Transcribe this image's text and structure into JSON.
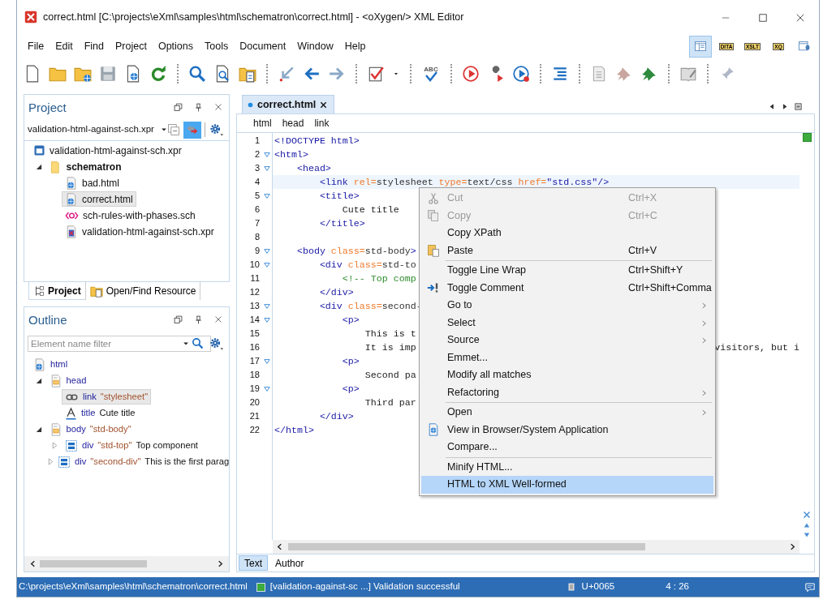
{
  "window": {
    "title": "correct.html [C:\\projects\\eXml\\samples\\html\\schematron\\correct.html] - <oXygen/> XML Editor"
  },
  "menu": [
    "File",
    "Edit",
    "Find",
    "Project",
    "Options",
    "Tools",
    "Document",
    "Window",
    "Help"
  ],
  "toolbar": {
    "spellcheck_label": "ABC"
  },
  "perspectives": [
    {
      "kind": "editor",
      "selected": true
    },
    {
      "kind": "tagged",
      "label": "DITA",
      "selected": false
    },
    {
      "kind": "tagged",
      "label": "XSLT",
      "selected": false
    },
    {
      "kind": "tagged",
      "label": "XQ",
      "selected": false
    },
    {
      "kind": "database",
      "selected": false
    }
  ],
  "project": {
    "title": "Project",
    "selector": "validation-html-against-sch.xpr",
    "tree": [
      {
        "label": "validation-html-against-sch.xpr",
        "kind": "project",
        "selected": false,
        "children": [
          {
            "label": "schematron",
            "kind": "folder",
            "selected": false,
            "expanded": true,
            "children": [
              {
                "label": "bad.html",
                "kind": "html",
                "selected": false
              },
              {
                "label": "correct.html",
                "kind": "html",
                "selected": true
              },
              {
                "label": "sch-rules-with-phases.sch",
                "kind": "sch",
                "selected": false
              },
              {
                "label": "validation-html-against-sch.xpr",
                "kind": "xpr",
                "selected": false
              }
            ]
          }
        ]
      }
    ],
    "tabs": [
      {
        "label": "Project",
        "selected": true
      },
      {
        "label": "Open/Find Resource",
        "selected": false
      }
    ]
  },
  "outline": {
    "title": "Outline",
    "filter": {
      "placeholder": "Element name filter"
    },
    "tree": [
      {
        "name": "html",
        "kind": "document",
        "selected": false,
        "children": [
          {
            "name": "head",
            "kind": "head",
            "selected": false,
            "expanded": true,
            "children": [
              {
                "name": "link",
                "attr": "\"stylesheet\"",
                "kind": "link",
                "selected": true
              },
              {
                "name": "title",
                "text": "Cute title",
                "kind": "title",
                "selected": false
              }
            ]
          },
          {
            "name": "body",
            "attr": "\"std-body\"",
            "kind": "head",
            "selected": false,
            "expanded": true,
            "children": [
              {
                "name": "div",
                "attr": "\"std-top\"",
                "text": "Top component",
                "kind": "div",
                "selected": false,
                "expanded": false
              },
              {
                "name": "div",
                "attr": "\"second-div\"",
                "text": "This is the first parag",
                "kind": "div",
                "selected": false,
                "expanded": false
              }
            ]
          }
        ]
      }
    ]
  },
  "editor": {
    "tab": {
      "label": "correct.html",
      "selected": true
    },
    "breadcrumb": [
      "html",
      "head",
      "link"
    ],
    "lines": [
      {
        "number": "1",
        "fold": false,
        "current": false,
        "tokens": [
          {
            "kind": "tag",
            "text": "<!DOCTYPE html>"
          }
        ]
      },
      {
        "number": "2",
        "fold": true,
        "current": false,
        "tokens": [
          {
            "kind": "tag",
            "text": "<html>"
          }
        ]
      },
      {
        "number": "3",
        "fold": true,
        "current": false,
        "tokens": [
          {
            "kind": "tag",
            "text": "    <head>"
          }
        ]
      },
      {
        "number": "4",
        "fold": false,
        "current": true,
        "tokens": [
          {
            "kind": "tag",
            "text": "        <link "
          },
          {
            "kind": "attr",
            "text": "rel="
          },
          {
            "kind": "value",
            "text": "stylesheet "
          },
          {
            "kind": "attr",
            "text": "type="
          },
          {
            "kind": "value",
            "text": "text/css "
          },
          {
            "kind": "attr",
            "text": "href="
          },
          {
            "kind": "string",
            "text": "\"std.css\""
          },
          {
            "kind": "tag",
            "text": "/>"
          }
        ]
      },
      {
        "number": "5",
        "fold": true,
        "current": false,
        "tokens": [
          {
            "kind": "tag",
            "text": "        <title>"
          }
        ]
      },
      {
        "number": "6",
        "fold": false,
        "current": false,
        "tokens": [
          {
            "kind": "text",
            "text": "            Cute title"
          }
        ]
      },
      {
        "number": "7",
        "fold": false,
        "current": false,
        "tokens": [
          {
            "kind": "tag",
            "text": "        </title>"
          }
        ]
      },
      {
        "number": "8",
        "fold": false,
        "current": false
      },
      {
        "number": "9",
        "fold": true,
        "current": false,
        "tokens": [
          {
            "kind": "tag",
            "text": "    <body "
          },
          {
            "kind": "attr",
            "text": "class="
          },
          {
            "kind": "value",
            "text": "std-body"
          },
          {
            "kind": "tag",
            "text": ">"
          }
        ]
      },
      {
        "number": "10",
        "fold": true,
        "current": false,
        "tokens": [
          {
            "kind": "tag",
            "text": "        <div "
          },
          {
            "kind": "attr",
            "text": "class="
          },
          {
            "kind": "value",
            "text": "std-to"
          }
        ]
      },
      {
        "number": "11",
        "fold": false,
        "current": false,
        "tokens": [
          {
            "kind": "comment",
            "text": "            <!-- Top comp"
          }
        ]
      },
      {
        "number": "12",
        "fold": false,
        "current": false,
        "tokens": [
          {
            "kind": "tag",
            "text": "        </div>"
          }
        ]
      },
      {
        "number": "13",
        "fold": true,
        "current": false,
        "tokens": [
          {
            "kind": "tag",
            "text": "        <div "
          },
          {
            "kind": "attr",
            "text": "class="
          },
          {
            "kind": "value",
            "text": "second-"
          }
        ]
      },
      {
        "number": "14",
        "fold": true,
        "current": false,
        "tokens": [
          {
            "kind": "tag",
            "text": "            <p>"
          }
        ]
      },
      {
        "number": "15",
        "fold": false,
        "current": false,
        "tokens": [
          {
            "kind": "text",
            "text": "                This is t"
          }
        ]
      },
      {
        "number": "16",
        "fold": false,
        "current": false,
        "tokens": [
          {
            "kind": "text",
            "text": "                It is imp"
          }
        ],
        "tail": "visitors, but i"
      },
      {
        "number": "17",
        "fold": true,
        "current": false,
        "tokens": [
          {
            "kind": "tag",
            "text": "            <p>"
          }
        ]
      },
      {
        "number": "18",
        "fold": false,
        "current": false,
        "tokens": [
          {
            "kind": "text",
            "text": "                Second pa"
          }
        ]
      },
      {
        "number": "19",
        "fold": true,
        "current": false,
        "tokens": [
          {
            "kind": "tag",
            "text": "            <p>"
          }
        ]
      },
      {
        "number": "20",
        "fold": false,
        "current": false,
        "tokens": [
          {
            "kind": "text",
            "text": "                Third par"
          }
        ]
      },
      {
        "number": "21",
        "fold": false,
        "current": false,
        "tokens": [
          {
            "kind": "tag",
            "text": "        </div>"
          }
        ]
      },
      {
        "number": "22",
        "fold": false,
        "current": false,
        "tokens": [
          {
            "kind": "tag",
            "text": "</html>"
          }
        ]
      }
    ],
    "modes": [
      {
        "label": "Text",
        "selected": true
      },
      {
        "label": "Author",
        "selected": false
      }
    ]
  },
  "context_menu": [
    [
      {
        "label": "Cut",
        "shortcut": "Ctrl+X",
        "disabled": true,
        "submenu": false,
        "selected": false
      },
      {
        "label": "Copy",
        "shortcut": "Ctrl+C",
        "disabled": true,
        "submenu": false,
        "selected": false
      },
      {
        "label": "Copy XPath",
        "disabled": false,
        "submenu": false,
        "selected": false
      },
      {
        "label": "Paste",
        "shortcut": "Ctrl+V",
        "disabled": false,
        "submenu": false,
        "selected": false
      }
    ],
    [
      {
        "label": "Toggle Line Wrap",
        "shortcut": "Ctrl+Shift+Y",
        "disabled": false,
        "submenu": false,
        "selected": false
      },
      {
        "label": "Toggle Comment",
        "shortcut": "Ctrl+Shift+Comma",
        "disabled": false,
        "submenu": false,
        "selected": false
      },
      {
        "label": "Go to",
        "disabled": false,
        "submenu": true,
        "selected": false
      },
      {
        "label": "Select",
        "disabled": false,
        "submenu": true,
        "selected": false
      },
      {
        "label": "Source",
        "disabled": false,
        "submenu": true,
        "selected": false
      },
      {
        "label": "Emmet...",
        "disabled": false,
        "submenu": false,
        "selected": false
      },
      {
        "label": "Modify all matches",
        "disabled": false,
        "submenu": false,
        "selected": false
      },
      {
        "label": "Refactoring",
        "disabled": false,
        "submenu": true,
        "selected": false
      }
    ],
    [
      {
        "label": "Open",
        "disabled": false,
        "submenu": true,
        "selected": false
      },
      {
        "label": "View in Browser/System Application",
        "disabled": false,
        "submenu": false,
        "selected": false
      },
      {
        "label": "Compare...",
        "disabled": false,
        "submenu": false,
        "selected": false
      }
    ],
    [
      {
        "label": "Minify HTML...",
        "disabled": false,
        "submenu": false,
        "selected": false
      },
      {
        "label": "HTML to XML Well-formed",
        "disabled": false,
        "submenu": false,
        "selected": true
      }
    ]
  ],
  "status_bar": {
    "path": "C:\\projects\\eXml\\samples\\html\\schematron\\correct.html",
    "valid": true,
    "message": "[validation-against-sc ...] Validation successful",
    "character": "U+0065",
    "position": "4 : 26"
  }
}
